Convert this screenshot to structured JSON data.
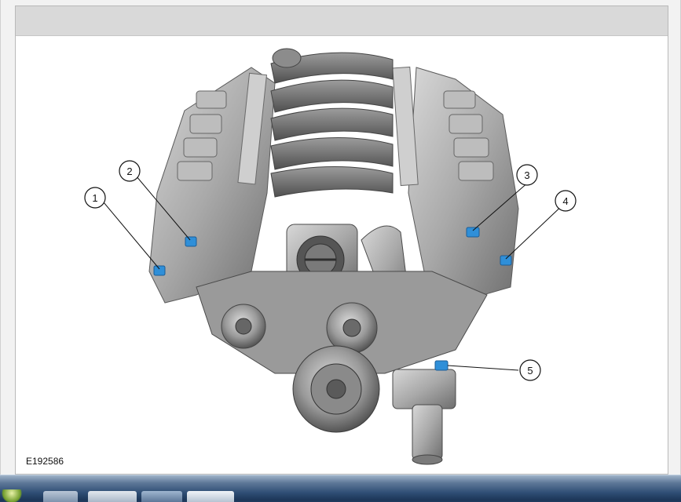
{
  "figure": {
    "id_label": "E192586",
    "callouts": [
      "1",
      "2",
      "3",
      "4",
      "5"
    ],
    "sensor_color": "#2f8fd8"
  },
  "colors": {
    "header_bar": "#d9d9d9",
    "taskbar": "#2e4d74"
  }
}
